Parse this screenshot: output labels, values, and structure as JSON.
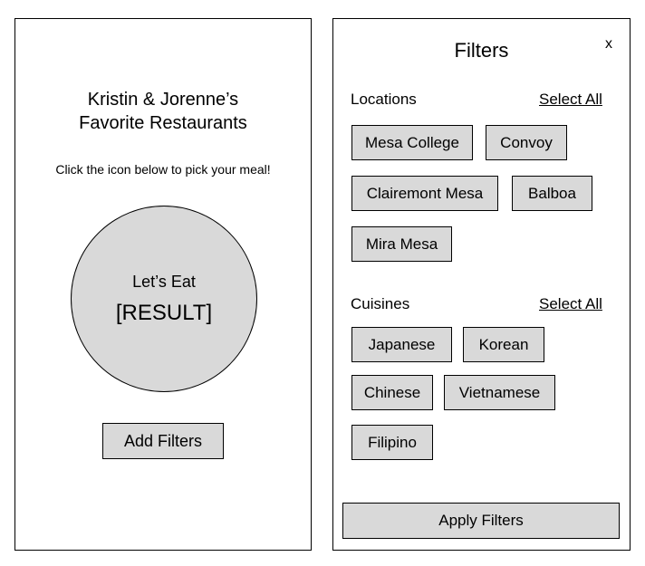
{
  "home": {
    "title_line1": "Kristin & Jorenne’s",
    "title_line2": "Favorite Restaurants",
    "instructions": "Click the icon below to pick your meal!",
    "circle_caption": "Let’s Eat",
    "circle_result": "[RESULT]",
    "add_filters_label": "Add Filters"
  },
  "filters": {
    "title": "Filters",
    "close_label": "x",
    "locations": {
      "label": "Locations",
      "select_all_label": "Select All",
      "options": [
        "Mesa College",
        "Convoy",
        "Clairemont Mesa",
        "Balboa",
        "Mira Mesa"
      ]
    },
    "cuisines": {
      "label": "Cuisines",
      "select_all_label": "Select All",
      "options": [
        "Japanese",
        "Korean",
        "Chinese",
        "Vietnamese",
        "Filipino"
      ]
    },
    "apply_label": "Apply Filters"
  },
  "colors": {
    "button_fill": "#d9d9d9",
    "border": "#000000",
    "background": "#ffffff"
  }
}
